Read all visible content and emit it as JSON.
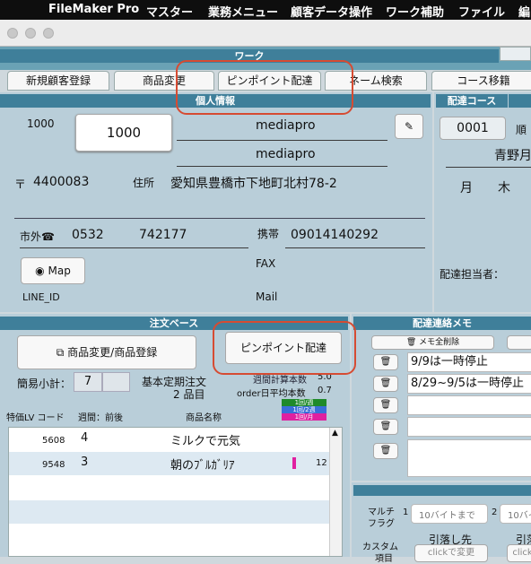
{
  "menubar": {
    "app": "FileMaker Pro",
    "items": [
      "マスター",
      "業務メニュー",
      "顧客データ操作",
      "ワーク補助",
      "ファイル",
      "編"
    ]
  },
  "window": {
    "title": "ワーク"
  },
  "tabs": [
    "新規顧客登録",
    "商品変更",
    "ピンポイント配達",
    "ネーム検索",
    "コース移籍"
  ],
  "customer": {
    "header": "個人情報",
    "id_label": "1000",
    "id_value": "1000",
    "name1": "mediapro",
    "name2": "mediapro",
    "zip_symbol": "〒",
    "zip": "4400083",
    "address_label": "住所",
    "address": "愛知県豊橋市下地町北村78-2",
    "area_label": "市外☎",
    "area_code": "0532",
    "phone": "742177",
    "mobile_label": "携帯",
    "mobile": "09014140292",
    "map_button": "Map",
    "fax_label": "FAX",
    "line_label": "LINE_ID",
    "mail_label": "Mail"
  },
  "course": {
    "header": "配達コース",
    "code": "0001",
    "order_label": "順",
    "area": "青野月",
    "days": [
      "月",
      "木"
    ],
    "staff_label": "配達担当者："
  },
  "order": {
    "header": "注文ベース",
    "change_button": "商品変更/商品登録",
    "pinpoint_button": "ピンポイント配達",
    "subtotal_label": "簡易小計：",
    "subtotal": "7",
    "regular_label": "基本定期注文",
    "regular_count": "2 品目",
    "weekly_label": "週間計算本数",
    "weekly_value": "5.0",
    "daily_label": "order日平均本数",
    "daily_value": "0.7",
    "legend": [
      "1回/週",
      "1回/2週",
      "1回/月"
    ],
    "legend_colors": [
      "#1f8a2a",
      "#3a6fd8",
      "#e020a0"
    ],
    "col_code": "特価LV コード",
    "col_week": "週間：前後",
    "col_name": "商品名称",
    "rows": [
      {
        "code": "5608",
        "qty": "4",
        "name": "ミルクで元気",
        "extra": ""
      },
      {
        "code": "9548",
        "qty": "3",
        "name": "朝のﾌﾞﾙｶﾞﾘｱ",
        "extra": "12"
      }
    ]
  },
  "memo": {
    "header": "配達連絡メモ",
    "clear_button": "メモ全削除",
    "notes": [
      "9/9は一時停止",
      "8/29~9/5は一時停止",
      "",
      "",
      ""
    ]
  },
  "bottom": {
    "multi_label1": "マルチ",
    "multi_label2": "フラグ",
    "f1": "1",
    "f1_placeholder": "10バイトまで",
    "f2": "2",
    "f2_placeholder": "10バイ",
    "custom_label1": "カスタム",
    "custom_label2": "項目",
    "pull_label": "引落し先",
    "pull_label2": "引落",
    "click_change": "clickで変更",
    "click2": "click"
  }
}
